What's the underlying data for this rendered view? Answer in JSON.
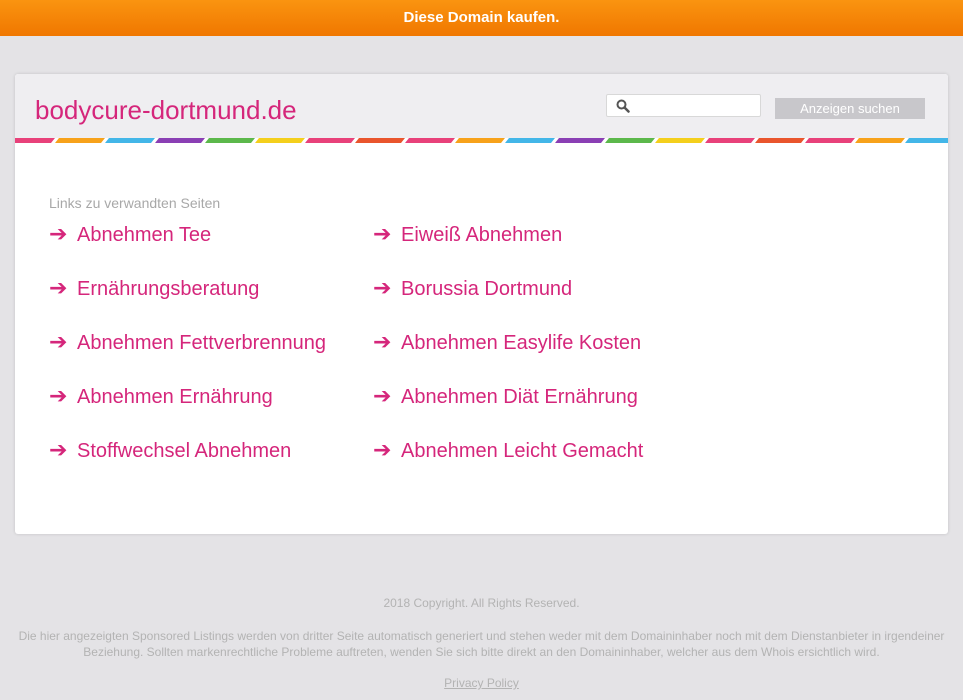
{
  "topbar": {
    "label": "Diese Domain kaufen."
  },
  "header": {
    "domain": "bodycure-dortmund.de",
    "search_placeholder": "",
    "search_button": "Anzeigen suchen"
  },
  "related": {
    "heading": "Links zu verwandten Seiten",
    "arrow": "➔",
    "column1": [
      "Abnehmen Tee",
      "Ernährungsberatung",
      "Abnehmen Fettverbrennung",
      "Abnehmen Ernährung",
      "Stoffwechsel Abnehmen"
    ],
    "column2": [
      "Eiweiß Abnehmen",
      "Borussia Dortmund",
      "Abnehmen Easylife Kosten",
      "Abnehmen Diät Ernährung",
      "Abnehmen Leicht Gemacht"
    ]
  },
  "footer": {
    "copyright": "2018 Copyright. All Rights Reserved.",
    "disclaimer": "Die hier angezeigten Sponsored Listings werden von dritter Seite automatisch generiert und stehen weder mit dem Domaininhaber noch mit dem Dienstanbieter in irgendeiner Beziehung. Sollten markenrechtliche Probleme auftreten, wenden Sie sich bitte direkt an den Domaininhaber, welcher aus dem Whois ersichtlich wird.",
    "privacy": "Privacy Policy"
  },
  "colors": {
    "accent": "#d5267b",
    "topbar": "#f58a0b",
    "stripes": [
      "#e8417a",
      "#f7a21b",
      "#43b6e8",
      "#8a3fb4",
      "#5cb84b",
      "#f4cf1d",
      "#e8417a",
      "#e9552d"
    ]
  },
  "icons": {
    "search": "magnifier-icon",
    "link_arrow": "arrow-right-icon"
  }
}
